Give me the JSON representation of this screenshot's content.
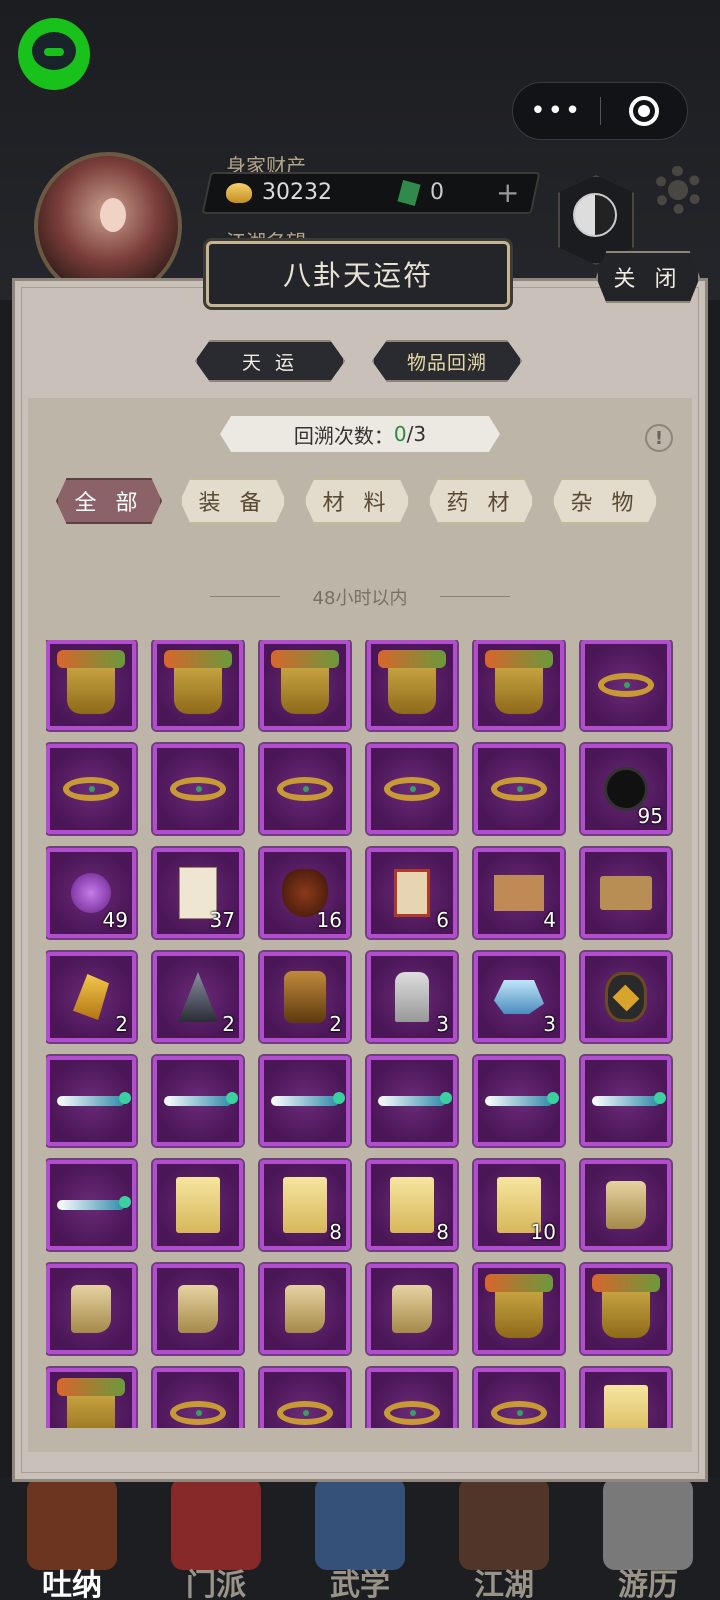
{
  "header": {
    "wealth_label": "身家财产",
    "coins": "30232",
    "jade": "0",
    "fame_label": "江湖名望"
  },
  "capsule": {
    "more": "•••"
  },
  "dialog": {
    "title": "八卦天运符",
    "close_label": "关 闭",
    "tabs": [
      {
        "label": "天 运"
      },
      {
        "label": "物品回溯"
      }
    ],
    "counter": {
      "label": "回溯次数：",
      "used": "0",
      "total": "/3"
    },
    "info": "!",
    "categories": [
      {
        "label": "全 部",
        "active": true
      },
      {
        "label": "装 备",
        "active": false
      },
      {
        "label": "材 料",
        "active": false
      },
      {
        "label": "药 材",
        "active": false
      },
      {
        "label": "杂 物",
        "active": false
      }
    ],
    "section_label": "48小时以内"
  },
  "items": [
    {
      "icon": "armor-icon",
      "qty": ""
    },
    {
      "icon": "armor-icon",
      "qty": ""
    },
    {
      "icon": "armor-icon",
      "qty": ""
    },
    {
      "icon": "armor-icon",
      "qty": ""
    },
    {
      "icon": "armor-icon",
      "qty": ""
    },
    {
      "icon": "ring-icon",
      "qty": ""
    },
    {
      "icon": "ring-icon",
      "qty": ""
    },
    {
      "icon": "ring-icon",
      "qty": ""
    },
    {
      "icon": "ring-icon",
      "qty": ""
    },
    {
      "icon": "ring-icon",
      "qty": ""
    },
    {
      "icon": "ring-icon",
      "qty": ""
    },
    {
      "icon": "black-disc-icon",
      "qty": "95"
    },
    {
      "icon": "purple-crystal-icon",
      "qty": "49"
    },
    {
      "icon": "scroll-paper-icon",
      "qty": "37"
    },
    {
      "icon": "wine-jar-icon",
      "qty": "16"
    },
    {
      "icon": "red-book-icon",
      "qty": "6"
    },
    {
      "icon": "board-icon",
      "qty": "4"
    },
    {
      "icon": "plank-icon",
      "qty": ""
    },
    {
      "icon": "gold-shard-icon",
      "qty": "2"
    },
    {
      "icon": "dark-shard-icon",
      "qty": "2"
    },
    {
      "icon": "golem-icon",
      "qty": "2"
    },
    {
      "icon": "stone-tablet-icon",
      "qty": "3"
    },
    {
      "icon": "ice-crystal-icon",
      "qty": "3"
    },
    {
      "icon": "oil-jar-icon",
      "qty": ""
    },
    {
      "icon": "sword-icon",
      "qty": ""
    },
    {
      "icon": "sword-icon",
      "qty": ""
    },
    {
      "icon": "sword-icon",
      "qty": ""
    },
    {
      "icon": "sword-icon",
      "qty": ""
    },
    {
      "icon": "sword-icon",
      "qty": ""
    },
    {
      "icon": "sword-icon",
      "qty": ""
    },
    {
      "icon": "sword-icon",
      "qty": ""
    },
    {
      "icon": "manual-scroll-icon",
      "qty": ""
    },
    {
      "icon": "manual-scroll-icon",
      "qty": "8"
    },
    {
      "icon": "manual-scroll-icon",
      "qty": "8"
    },
    {
      "icon": "manual-scroll-icon",
      "qty": "10"
    },
    {
      "icon": "boots-icon",
      "qty": ""
    },
    {
      "icon": "boots-icon",
      "qty": ""
    },
    {
      "icon": "boots-icon",
      "qty": ""
    },
    {
      "icon": "boots-icon",
      "qty": ""
    },
    {
      "icon": "boots-icon",
      "qty": ""
    },
    {
      "icon": "armor-icon",
      "qty": ""
    },
    {
      "icon": "armor-icon",
      "qty": ""
    },
    {
      "icon": "armor-icon",
      "qty": ""
    },
    {
      "icon": "ring-icon",
      "qty": ""
    },
    {
      "icon": "ring-icon",
      "qty": ""
    },
    {
      "icon": "ring-icon",
      "qty": ""
    },
    {
      "icon": "ring-icon",
      "qty": ""
    },
    {
      "icon": "manual-scroll-icon",
      "qty": ""
    }
  ],
  "bottom_nav": [
    {
      "label": "吐纳",
      "active": true,
      "color": "#7a3a20"
    },
    {
      "label": "门派",
      "active": false,
      "color": "#9a2a2a"
    },
    {
      "label": "武学",
      "active": false,
      "color": "#3a5a8a"
    },
    {
      "label": "江湖",
      "active": false,
      "color": "#5a3a2a"
    },
    {
      "label": "游历",
      "active": false,
      "color": "#8a8a8a"
    }
  ]
}
